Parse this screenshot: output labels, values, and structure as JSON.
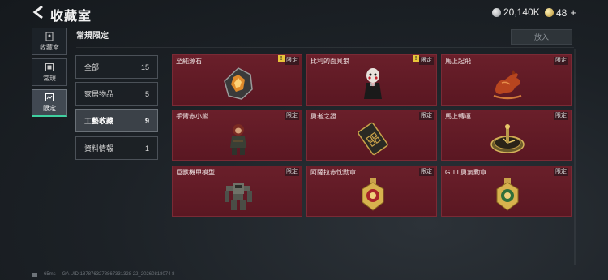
{
  "header": {
    "title": "收藏室",
    "currency_silver": "20,140K",
    "currency_gold": "48",
    "currency_gold_plus": "+"
  },
  "nav": [
    {
      "label": "收藏室",
      "icon": "collection-icon"
    },
    {
      "label": "常規",
      "icon": "regular-icon"
    },
    {
      "label": "限定",
      "icon": "limited-icon"
    }
  ],
  "section": {
    "title": "常規限定",
    "put_label": "放入"
  },
  "categories": [
    {
      "label": "全部",
      "count": "15"
    },
    {
      "label": "家居物品",
      "count": "5"
    },
    {
      "label": "工藝收藏",
      "count": "9"
    },
    {
      "label": "資料情報",
      "count": "1"
    }
  ],
  "items": [
    {
      "name": "至純源石",
      "badge": "限定",
      "notify": "!",
      "icon": "gem-icon"
    },
    {
      "name": "比利的面具狼",
      "badge": "限定",
      "notify": "!",
      "icon": "puppet-icon"
    },
    {
      "name": "馬上起飛",
      "badge": "限定",
      "icon": "horse-icon"
    },
    {
      "name": "手臂赤小熊",
      "badge": "限定",
      "icon": "figure-icon"
    },
    {
      "name": "勇者之證",
      "badge": "限定",
      "icon": "card-icon"
    },
    {
      "name": "馬上轉運",
      "badge": "限定",
      "icon": "clock-icon"
    },
    {
      "name": "巨獸機甲模型",
      "badge": "限定",
      "icon": "mech-icon"
    },
    {
      "name": "阿薩拉赤忱勳章",
      "badge": "限定",
      "icon": "medal-red-icon"
    },
    {
      "name": "G.T.I.勇氣勳章",
      "badge": "限定",
      "icon": "medal-green-icon"
    }
  ],
  "footer": {
    "ping": "65ms",
    "uid": "GA UID:1878763278867331328 22_20260818074 8"
  },
  "colors": {
    "card_bg": "#5e1a25",
    "active_accent": "#3fd0a0",
    "notify": "#e8c53a"
  }
}
